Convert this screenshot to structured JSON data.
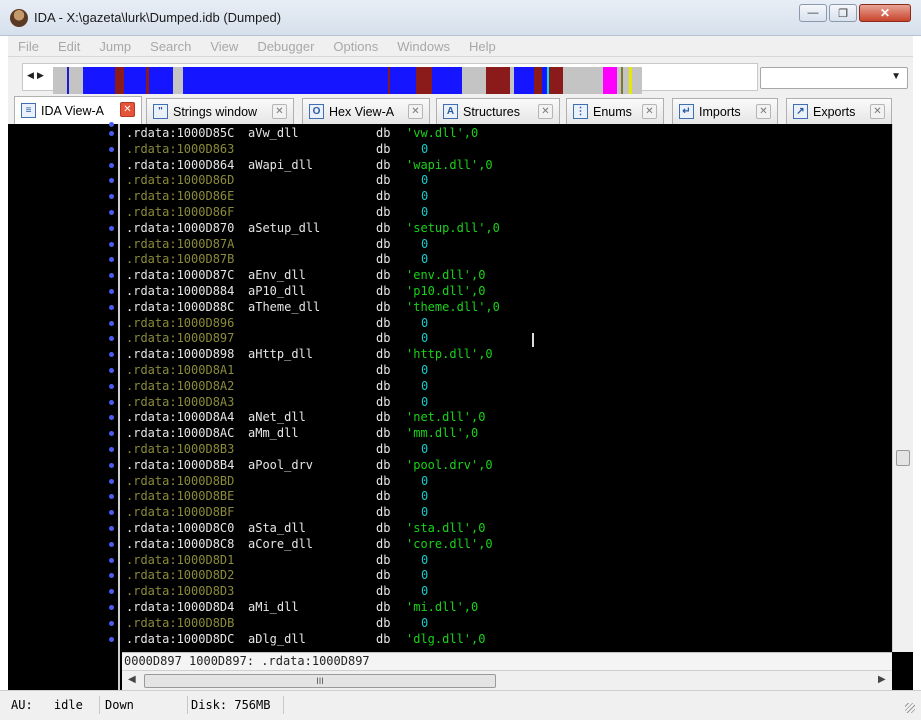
{
  "window": {
    "title": "IDA - X:\\gazeta\\lurk\\Dumped.idb (Dumped)"
  },
  "menu": [
    "File",
    "Edit",
    "Jump",
    "Search",
    "View",
    "Debugger",
    "Options",
    "Windows",
    "Help"
  ],
  "colors": {
    "navy": "#1a1ad0",
    "blue": "#1515ff",
    "maroon": "#8b1a1a",
    "gray": "#c4c4c4",
    "magenta": "#ff00ff",
    "cyan": "#00e0e0",
    "olive": "#7a7a30",
    "yellow": "#e8e800"
  },
  "navband": [
    {
      "c": "gray",
      "w": 14
    },
    {
      "c": "navy",
      "w": 2
    },
    {
      "c": "gray",
      "w": 14
    },
    {
      "c": "blue",
      "w": 32
    },
    {
      "c": "maroon",
      "w": 9
    },
    {
      "c": "blue",
      "w": 22
    },
    {
      "c": "maroon",
      "w": 3
    },
    {
      "c": "blue",
      "w": 24
    },
    {
      "c": "gray",
      "w": 10
    },
    {
      "c": "blue",
      "w": 205
    },
    {
      "c": "maroon",
      "w": 2
    },
    {
      "c": "blue",
      "w": 26
    },
    {
      "c": "maroon",
      "w": 16
    },
    {
      "c": "blue",
      "w": 30
    },
    {
      "c": "gray",
      "w": 24
    },
    {
      "c": "maroon",
      "w": 24
    },
    {
      "c": "gray",
      "w": 4
    },
    {
      "c": "blue",
      "w": 20
    },
    {
      "c": "maroon",
      "w": 8
    },
    {
      "c": "blue",
      "w": 5
    },
    {
      "c": "cyan",
      "w": 2
    },
    {
      "c": "maroon",
      "w": 14
    },
    {
      "c": "gray",
      "w": 40
    },
    {
      "c": "magenta",
      "w": 14
    },
    {
      "c": "gray",
      "w": 4
    },
    {
      "c": "olive",
      "w": 2
    },
    {
      "c": "gray",
      "w": 6
    },
    {
      "c": "yellow",
      "w": 3
    },
    {
      "c": "gray",
      "w": 10
    }
  ],
  "tabs": [
    {
      "label": "IDA View-A",
      "icon": "ida-view-icon",
      "active": true
    },
    {
      "label": "Strings window",
      "icon": "strings-icon",
      "active": false
    },
    {
      "label": "Hex View-A",
      "icon": "hex-view-icon",
      "active": false
    },
    {
      "label": "Structures",
      "icon": "structures-icon",
      "active": false
    },
    {
      "label": "Enums",
      "icon": "enums-icon",
      "active": false
    },
    {
      "label": "Imports",
      "icon": "imports-icon",
      "active": false
    },
    {
      "label": "Exports",
      "icon": "exports-icon",
      "active": false
    }
  ],
  "listing": [
    {
      "addr": ".rdata:1000D85C",
      "label": "aVw_dll",
      "mnem": "db",
      "str": "'vw.dll'",
      "num": ",0",
      "named": true
    },
    {
      "addr": ".rdata:1000D863",
      "label": "",
      "mnem": "db",
      "str": "",
      "num": "0",
      "named": false
    },
    {
      "addr": ".rdata:1000D864",
      "label": "aWapi_dll",
      "mnem": "db",
      "str": "'wapi.dll'",
      "num": ",0",
      "named": true
    },
    {
      "addr": ".rdata:1000D86D",
      "label": "",
      "mnem": "db",
      "str": "",
      "num": "0",
      "named": false
    },
    {
      "addr": ".rdata:1000D86E",
      "label": "",
      "mnem": "db",
      "str": "",
      "num": "0",
      "named": false
    },
    {
      "addr": ".rdata:1000D86F",
      "label": "",
      "mnem": "db",
      "str": "",
      "num": "0",
      "named": false
    },
    {
      "addr": ".rdata:1000D870",
      "label": "aSetup_dll",
      "mnem": "db",
      "str": "'setup.dll'",
      "num": ",0",
      "named": true
    },
    {
      "addr": ".rdata:1000D87A",
      "label": "",
      "mnem": "db",
      "str": "",
      "num": "0",
      "named": false
    },
    {
      "addr": ".rdata:1000D87B",
      "label": "",
      "mnem": "db",
      "str": "",
      "num": "0",
      "named": false
    },
    {
      "addr": ".rdata:1000D87C",
      "label": "aEnv_dll",
      "mnem": "db",
      "str": "'env.dll'",
      "num": ",0",
      "named": true
    },
    {
      "addr": ".rdata:1000D884",
      "label": "aP10_dll",
      "mnem": "db",
      "str": "'p10.dll'",
      "num": ",0",
      "named": true
    },
    {
      "addr": ".rdata:1000D88C",
      "label": "aTheme_dll",
      "mnem": "db",
      "str": "'theme.dll'",
      "num": ",0",
      "named": true
    },
    {
      "addr": ".rdata:1000D896",
      "label": "",
      "mnem": "db",
      "str": "",
      "num": "0",
      "named": false
    },
    {
      "addr": ".rdata:1000D897",
      "label": "",
      "mnem": "db",
      "str": "",
      "num": "0",
      "named": false
    },
    {
      "addr": ".rdata:1000D898",
      "label": "aHttp_dll",
      "mnem": "db",
      "str": "'http.dll'",
      "num": ",0",
      "named": true
    },
    {
      "addr": ".rdata:1000D8A1",
      "label": "",
      "mnem": "db",
      "str": "",
      "num": "0",
      "named": false
    },
    {
      "addr": ".rdata:1000D8A2",
      "label": "",
      "mnem": "db",
      "str": "",
      "num": "0",
      "named": false
    },
    {
      "addr": ".rdata:1000D8A3",
      "label": "",
      "mnem": "db",
      "str": "",
      "num": "0",
      "named": false
    },
    {
      "addr": ".rdata:1000D8A4",
      "label": "aNet_dll",
      "mnem": "db",
      "str": "'net.dll'",
      "num": ",0",
      "named": true
    },
    {
      "addr": ".rdata:1000D8AC",
      "label": "aMm_dll",
      "mnem": "db",
      "str": "'mm.dll'",
      "num": ",0",
      "named": true
    },
    {
      "addr": ".rdata:1000D8B3",
      "label": "",
      "mnem": "db",
      "str": "",
      "num": "0",
      "named": false
    },
    {
      "addr": ".rdata:1000D8B4",
      "label": "aPool_drv",
      "mnem": "db",
      "str": "'pool.drv'",
      "num": ",0",
      "named": true
    },
    {
      "addr": ".rdata:1000D8BD",
      "label": "",
      "mnem": "db",
      "str": "",
      "num": "0",
      "named": false
    },
    {
      "addr": ".rdata:1000D8BE",
      "label": "",
      "mnem": "db",
      "str": "",
      "num": "0",
      "named": false
    },
    {
      "addr": ".rdata:1000D8BF",
      "label": "",
      "mnem": "db",
      "str": "",
      "num": "0",
      "named": false
    },
    {
      "addr": ".rdata:1000D8C0",
      "label": "aSta_dll",
      "mnem": "db",
      "str": "'sta.dll'",
      "num": ",0",
      "named": true
    },
    {
      "addr": ".rdata:1000D8C8",
      "label": "aCore_dll",
      "mnem": "db",
      "str": "'core.dll'",
      "num": ",0",
      "named": true
    },
    {
      "addr": ".rdata:1000D8D1",
      "label": "",
      "mnem": "db",
      "str": "",
      "num": "0",
      "named": false
    },
    {
      "addr": ".rdata:1000D8D2",
      "label": "",
      "mnem": "db",
      "str": "",
      "num": "0",
      "named": false
    },
    {
      "addr": ".rdata:1000D8D3",
      "label": "",
      "mnem": "db",
      "str": "",
      "num": "0",
      "named": false
    },
    {
      "addr": ".rdata:1000D8D4",
      "label": "aMi_dll",
      "mnem": "db",
      "str": "'mi.dll'",
      "num": ",0",
      "named": true
    },
    {
      "addr": ".rdata:1000D8DB",
      "label": "",
      "mnem": "db",
      "str": "",
      "num": "0",
      "named": false
    },
    {
      "addr": ".rdata:1000D8DC",
      "label": "aDlg_dll",
      "mnem": "db",
      "str": "'dlg.dll'",
      "num": ",0",
      "named": true
    }
  ],
  "address_bar": "0000D897 1000D897: .rdata:1000D897",
  "hscroll_grip": "III",
  "status": {
    "au_label": "AU:",
    "au_state": "idle",
    "direction": "Down",
    "disk": "Disk: 756MB"
  }
}
